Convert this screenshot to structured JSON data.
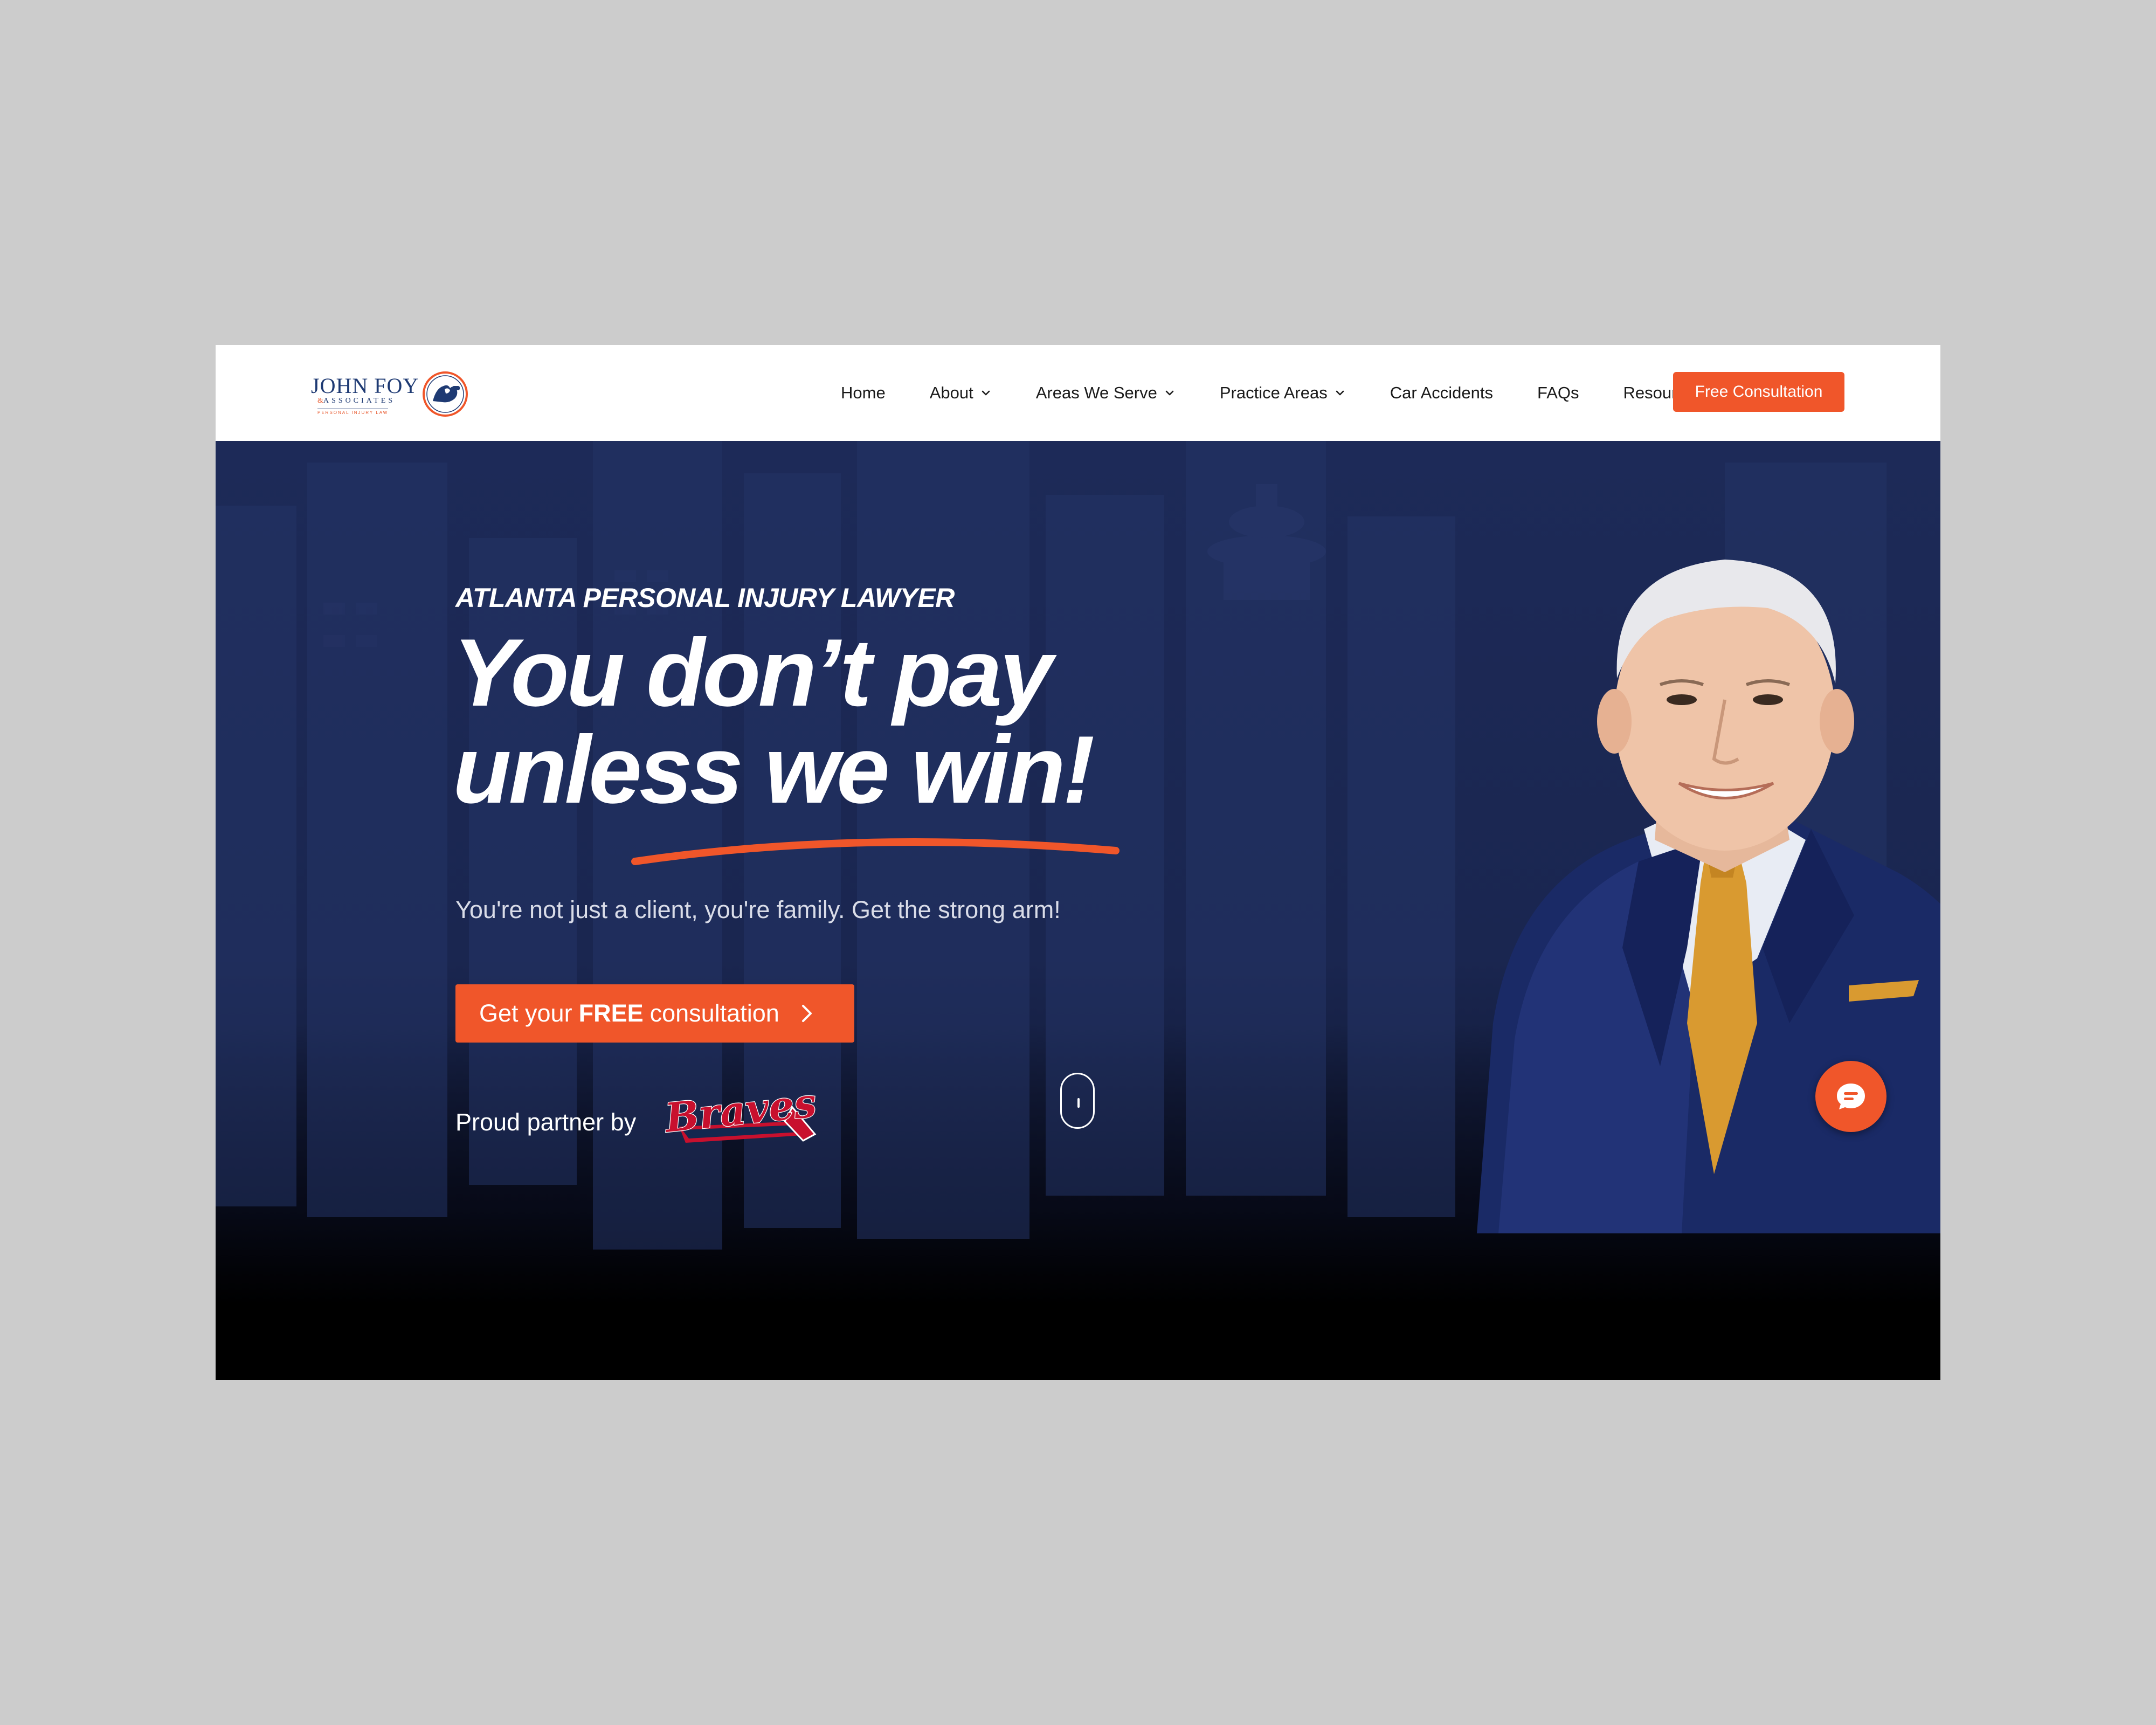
{
  "brand": {
    "name_line1": "JOHN FOY",
    "name_line2_amp": "&",
    "name_line2": "ASSOCIATES",
    "tagline": "PERSONAL INJURY LAW",
    "accent_color": "#f0562a",
    "navy_color": "#1e3a73"
  },
  "nav": {
    "items": [
      {
        "label": "Home",
        "has_dropdown": false
      },
      {
        "label": "About",
        "has_dropdown": true
      },
      {
        "label": "Areas We Serve",
        "has_dropdown": true
      },
      {
        "label": "Practice Areas",
        "has_dropdown": true
      },
      {
        "label": "Car Accidents",
        "has_dropdown": false
      },
      {
        "label": "FAQs",
        "has_dropdown": false
      },
      {
        "label": "Resources",
        "has_dropdown": false
      }
    ],
    "cta_label": "Free Consultation"
  },
  "hero": {
    "eyebrow": "ATLANTA PERSONAL INJURY LAWYER",
    "headline_line1": "You don’t pay",
    "headline_line2": "unless we win!",
    "subhead": "You're not just a client, you're family. Get the strong arm!",
    "cta_prefix": "Get your",
    "cta_bold": "FREE",
    "cta_suffix": "consultation",
    "partner_label": "Proud partner by",
    "partner_logo_text": "Braves"
  },
  "icons": {
    "dropdown": "chevron-down-icon",
    "cta_arrow": "chevron-right-icon",
    "chat": "chat-bubble-icon",
    "scroll": "scroll-mouse-icon"
  }
}
